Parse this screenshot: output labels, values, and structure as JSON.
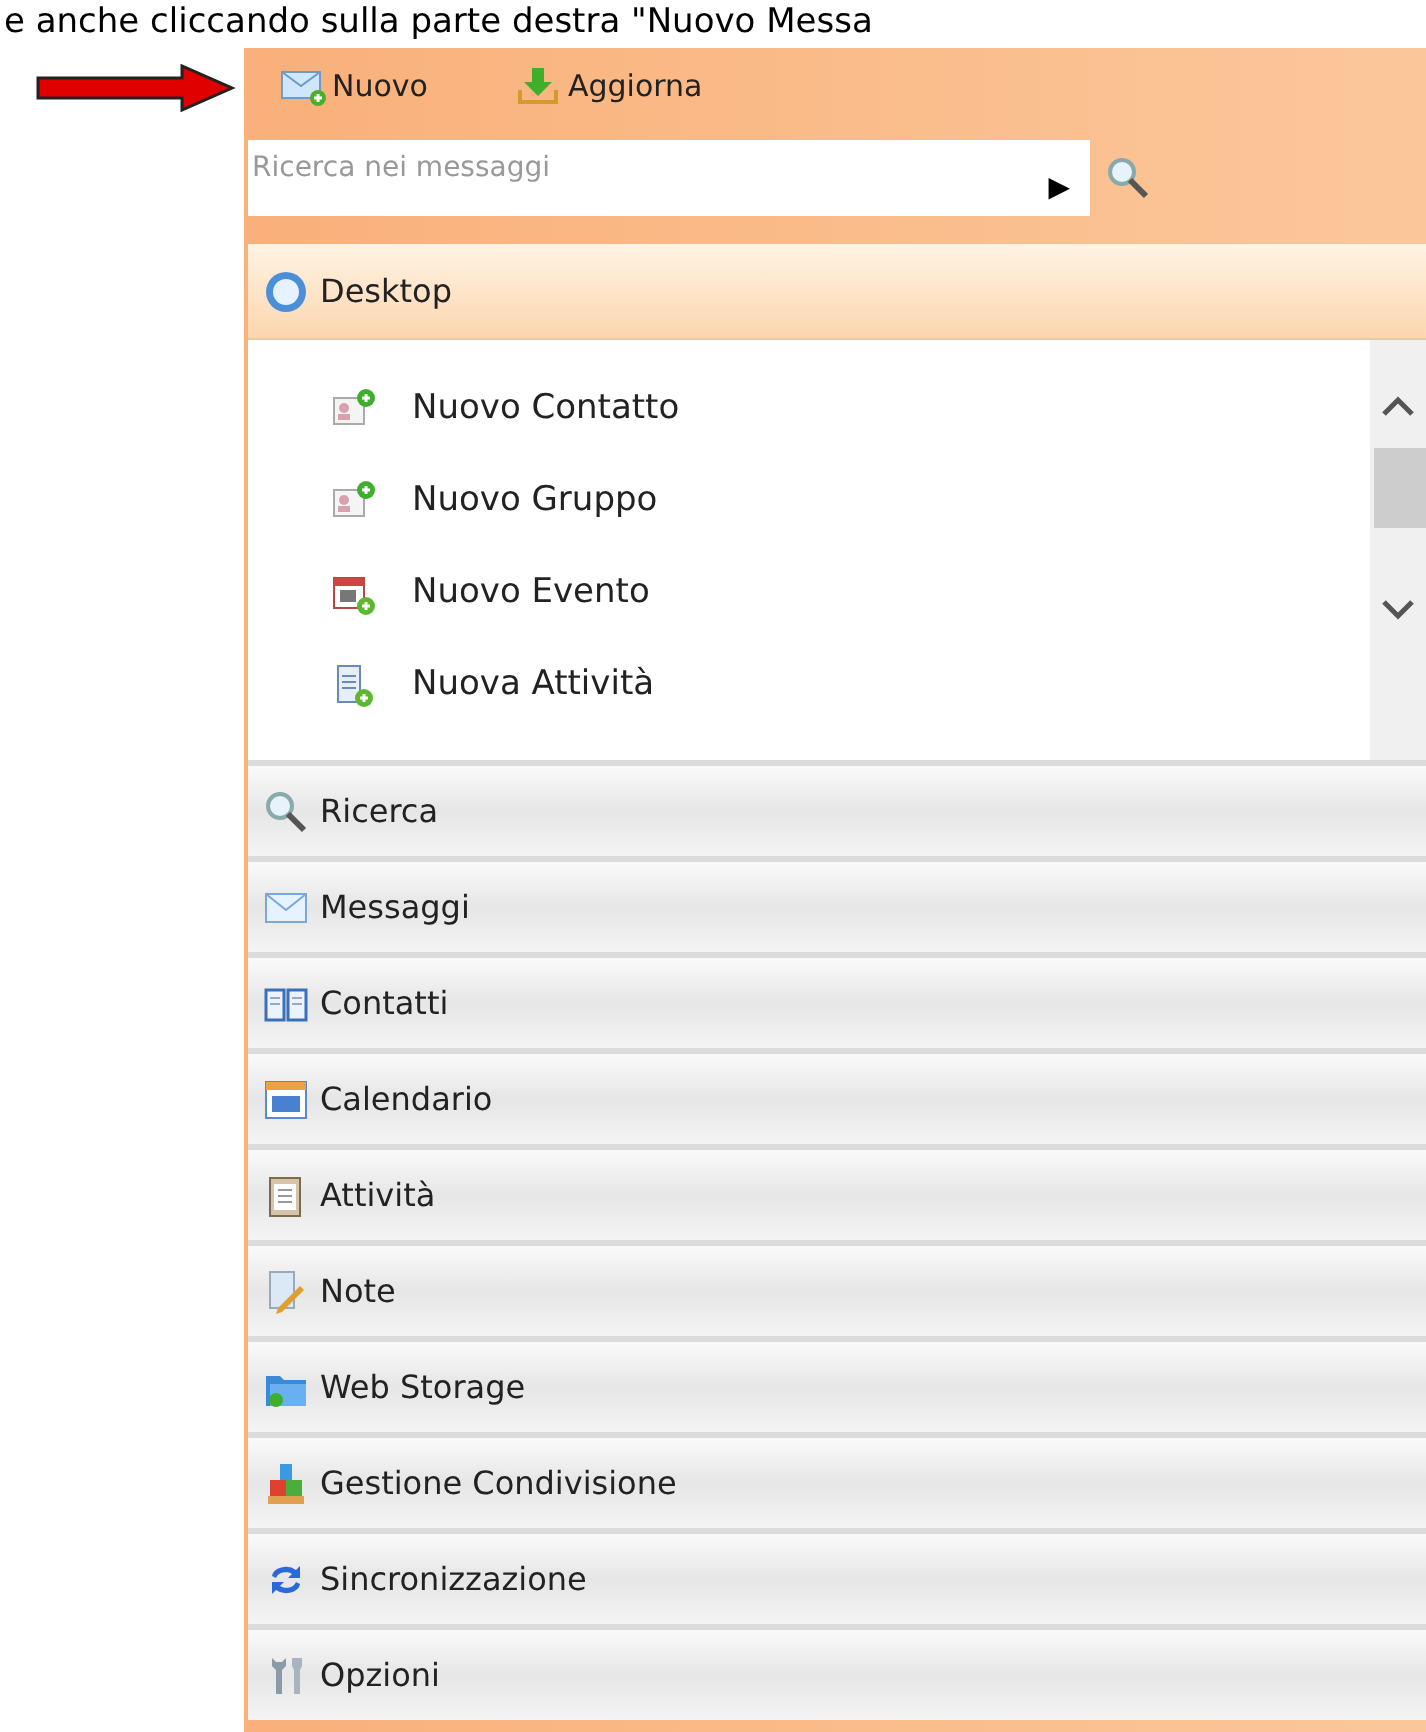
{
  "caption": "e anche cliccando sulla parte destra \"Nuovo Messa",
  "toolbar": [
    {
      "label": "Nuovo",
      "kind": "new"
    },
    {
      "label": "Aggiorna",
      "kind": "refresh"
    }
  ],
  "search": {
    "placeholder": "Ricerca nei messaggi",
    "arrow": "▶"
  },
  "sections": [
    {
      "label": "Desktop",
      "kind": "desktop",
      "expanded": true,
      "items": [
        {
          "label": "Nuovo Contatto",
          "kind": "contact"
        },
        {
          "label": "Nuovo Gruppo",
          "kind": "contact"
        },
        {
          "label": "Nuovo Evento",
          "kind": "event"
        },
        {
          "label": "Nuova Attività",
          "kind": "task"
        }
      ]
    },
    {
      "label": "Ricerca",
      "kind": "search",
      "expanded": false
    },
    {
      "label": "Messaggi",
      "kind": "mail",
      "expanded": false
    },
    {
      "label": "Contatti",
      "kind": "book",
      "expanded": false
    },
    {
      "label": "Calendario",
      "kind": "calendar",
      "expanded": false
    },
    {
      "label": "Attività",
      "kind": "clipboard",
      "expanded": false
    },
    {
      "label": "Note",
      "kind": "note",
      "expanded": false
    },
    {
      "label": "Web Storage",
      "kind": "folder",
      "expanded": false
    },
    {
      "label": "Gestione Condivisione",
      "kind": "share",
      "expanded": false
    },
    {
      "label": "Sincronizzazione",
      "kind": "sync",
      "expanded": false
    },
    {
      "label": "Opzioni",
      "kind": "tools",
      "expanded": false
    }
  ]
}
